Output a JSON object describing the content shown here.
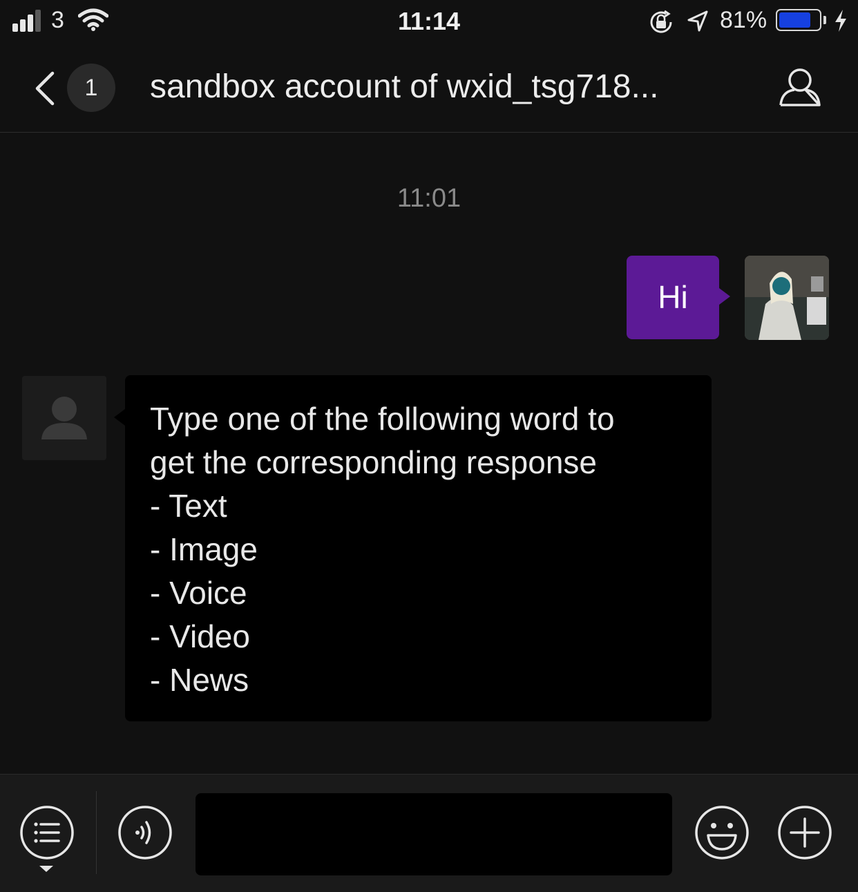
{
  "status_bar": {
    "carrier": "3",
    "time": "11:14",
    "battery_percent": "81%",
    "battery_level": 0.81,
    "icons": [
      "signal-icon",
      "wifi-icon",
      "rotation-lock-icon",
      "location-icon",
      "battery-icon",
      "charging-icon"
    ]
  },
  "nav": {
    "unread_count": "1",
    "title": "sandbox account of wxid_tsg718..."
  },
  "chat": {
    "timestamp": "11:01",
    "messages": [
      {
        "sender": "me",
        "text": "Hi"
      },
      {
        "sender": "them",
        "text": "Type one of the following word to\nget the corresponding response\n- Text\n- Image\n- Voice\n- Video\n- News"
      }
    ]
  },
  "input_bar": {
    "input_value": "",
    "icons": [
      "menu-icon",
      "voice-icon",
      "emoji-icon",
      "plus-icon"
    ]
  },
  "colors": {
    "outgoing_bubble": "#5c1a96",
    "incoming_bubble": "#000000",
    "background": "#111111"
  }
}
